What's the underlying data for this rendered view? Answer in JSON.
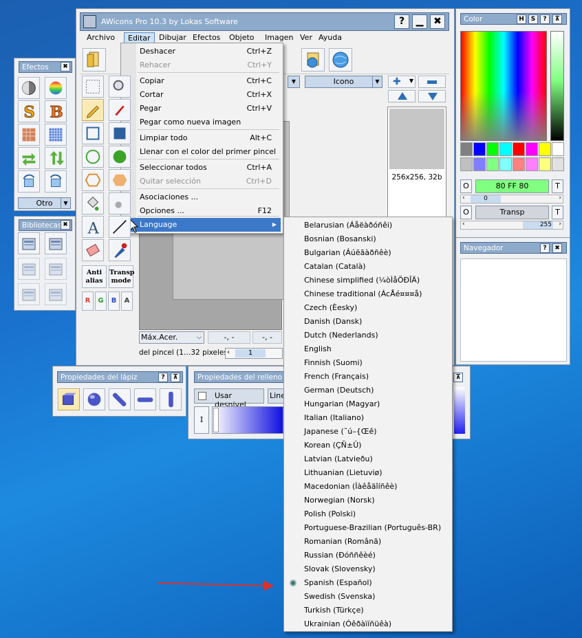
{
  "main_window": {
    "title": "AWicons Pro 10.3 by Lokas Software",
    "menu": [
      "Archivo",
      "Editar",
      "Dibujar",
      "Efectos",
      "Objeto",
      "Imagen",
      "Ver",
      "Ayuda"
    ],
    "view_mode": "Icono",
    "size_label": "256x256, 32b",
    "zoom_select": "Máx.Acer.",
    "coord_x": "-, -",
    "coord_y": "-, -",
    "pencil_size_label": "del pincel (1…32 pixeles)",
    "pencil_size_value": "1"
  },
  "edit_menu": [
    {
      "label": "Deshacer",
      "shortcut": "Ctrl+Z",
      "disabled": false
    },
    {
      "label": "Rehacer",
      "shortcut": "Ctrl+Y",
      "disabled": true
    },
    {
      "label": "Copiar",
      "shortcut": "Ctrl+C",
      "disabled": false
    },
    {
      "label": "Cortar",
      "shortcut": "Ctrl+X",
      "disabled": false
    },
    {
      "label": "Pegar",
      "shortcut": "Ctrl+V",
      "disabled": false
    },
    {
      "label": "Pegar como nueva imagen",
      "shortcut": "",
      "disabled": false
    },
    {
      "label": "Limpiar todo",
      "shortcut": "Alt+C",
      "disabled": false
    },
    {
      "label": "Llenar con el color del primer pincel",
      "shortcut": "",
      "disabled": false
    },
    {
      "label": "Seleccionar todos",
      "shortcut": "Ctrl+A",
      "disabled": false
    },
    {
      "label": "Quitar selección",
      "shortcut": "Ctrl+D",
      "disabled": true
    },
    {
      "label": "Asociaciones ...",
      "shortcut": "",
      "disabled": false
    },
    {
      "label": "Opciones ...",
      "shortcut": "F12",
      "disabled": false
    },
    {
      "label": "Language",
      "shortcut": "",
      "disabled": false
    }
  ],
  "languages": [
    "Belarusian (Áåëàðóñêi)",
    "Bosnian (Bosanski)",
    "Bulgarian (Áúëãàðñêè)",
    "Catalan (Català)",
    "Chinese simplified (¼òÌåÖÐÎÄ)",
    "Chinese traditional (ÁcÅé¤¤¤å)",
    "Czech (Èesky)",
    "Danish (Dansk)",
    "Dutch (Nederlands)",
    "English",
    "Finnish (Suomi)",
    "French (Français)",
    "German (Deutsch)",
    "Hungarian (Magyar)",
    "Italian (Italiano)",
    "Japanese (˜ú–{Œê)",
    "Korean (ÇÑ±Û)",
    "Latvian (Latvieðu)",
    "Lithuanian (Lietuviø)",
    "Macedonian (Ìàêåäîíñêè)",
    "Norwegian (Norsk)",
    "Polish (Polski)",
    "Portuguese-Brazilian (Português-BR)",
    "Romanian (Românã)",
    "Russian (Ðóññêèé)",
    "Slovak (Slovensky)",
    "Spanish (Español)",
    "Swedish (Svenska)",
    "Turkish (Türkçe)",
    "Ukrainian (Óêðàїíñüêà)"
  ],
  "selected_language": "Spanish (Español)",
  "efectos": {
    "title": "Efectos",
    "dropdown": "Otro"
  },
  "bibliotecas": {
    "title": "Bibliotecas"
  },
  "tools": {
    "antialias": "Anti alias",
    "transp": "Transp mode",
    "channels": [
      "R",
      "G",
      "B",
      "A"
    ]
  },
  "color": {
    "title": "Color",
    "hex": "80 FF 80",
    "alpha_value": "0",
    "transp": "Transp",
    "transp_value": "255",
    "o1": "O",
    "t1": "T",
    "o2": "O",
    "t2": "T",
    "swatches": [
      "#808080",
      "#0000ff",
      "#00ff00",
      "#00ffff",
      "#ff0000",
      "#ff00ff",
      "#ffff00",
      "#ffffff",
      "#c0c0c0",
      "#8080ff",
      "#80ff80",
      "#80ffff",
      "#ff8080",
      "#ff80ff",
      "#ffff80",
      "#e0e0e0"
    ]
  },
  "navegador": {
    "title": "Navegador"
  },
  "lapiz": {
    "title": "Propiedades del lápiz"
  },
  "relleno": {
    "title": "Propiedades del relleno",
    "checkbox": "Usar desnivel",
    "line_btn": "Line",
    "i_label": "I"
  }
}
